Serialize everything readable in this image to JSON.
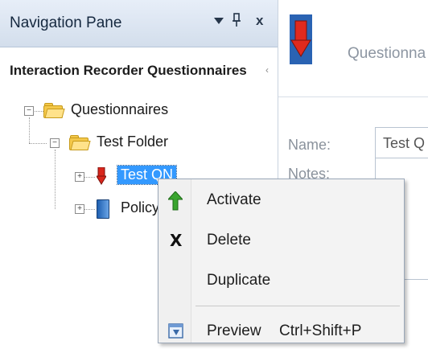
{
  "nav_pane": {
    "title": "Navigation Pane",
    "pin_glyph": "ș",
    "close_glyph": "x",
    "section_title": "Interaction Recorder Questionnaires",
    "section_more": "‹"
  },
  "tree": {
    "root": {
      "label": "Questionnaires",
      "expander": "−"
    },
    "folder": {
      "label": "Test Folder",
      "expander": "−"
    },
    "items": [
      {
        "label": "Test QN",
        "icon": "red-questionnaire-icon",
        "expander": "+",
        "selected": true
      },
      {
        "label": "Policy",
        "icon": "blue-questionnaire-icon",
        "expander": "+",
        "selected": false
      }
    ]
  },
  "detail": {
    "heading": "Questionna",
    "name_label": "Name:",
    "name_value": "Test Q",
    "notes_label": "Notes:"
  },
  "context_menu": {
    "items": [
      {
        "label": "Activate",
        "icon": "green-up-arrow-icon",
        "shortcut": ""
      },
      {
        "label": "Delete",
        "icon": "x-icon",
        "shortcut": ""
      },
      {
        "label": "Duplicate",
        "icon": "",
        "shortcut": ""
      },
      {
        "label": "Preview",
        "icon": "preview-icon",
        "shortcut": "Ctrl+Shift+P"
      }
    ],
    "delete_glyph": "X"
  },
  "colors": {
    "header_bg": "#dce5f1",
    "selection": "#3399ff",
    "folder": "#f4c84a",
    "activate_green": "#3aa52f",
    "questionnaire_red": "#d9261c"
  }
}
